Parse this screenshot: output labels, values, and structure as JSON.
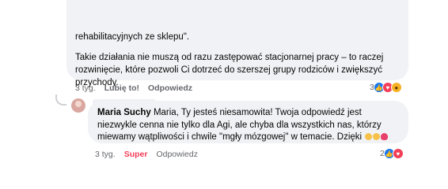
{
  "comment1": {
    "line_top": "rehabilitacyjnych ze sklepu\".",
    "paragraph": "Takie działania nie muszą od razu zastępować stacjonarnej pracy – to raczej rozwinięcie, które pozwoli Ci dotrzeć do szerszej grupy rodziców i zwiększyć przychody.",
    "time": "3 tyg.",
    "like_label": "Lubię to!",
    "reply_label": "Odpowiedz",
    "reaction_count": "3",
    "reactions": [
      "like-icon",
      "love-icon",
      "wow-icon"
    ]
  },
  "comment2": {
    "author": "Maria Suchy",
    "text": " Maria, Ty jesteś niesamowita! Twoja odpowiedź jest niezwykle cenna nie tylko dla Agi, ale chyba dla wszystkich nas, którzy miewamy wątpliwości i chwile \"mgły mózgowej\" w temacie. Dzięki",
    "time": "3 tyg.",
    "like_label": "Super",
    "reply_label": "Odpowiedz",
    "reaction_count": "2",
    "reactions": [
      "like-icon",
      "love-icon"
    ]
  },
  "colors": {
    "accent_like": "#1877f2",
    "super_label": "#f33e58",
    "bubble_bg": "#f0f2f5",
    "meta_text": "#65676b"
  }
}
